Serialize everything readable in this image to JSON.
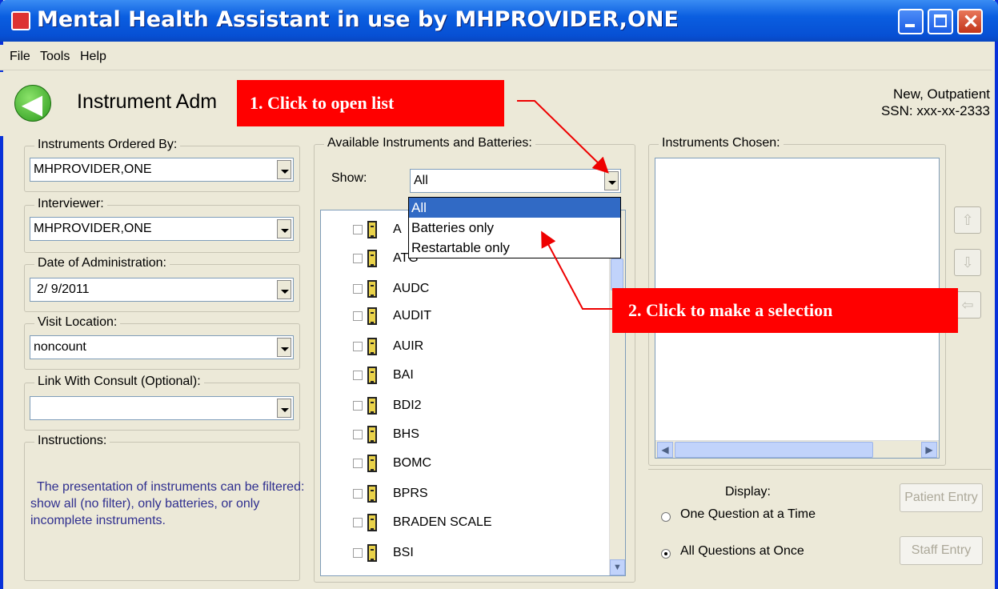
{
  "window": {
    "title": "Mental Health Assistant in use by MHPROVIDER,ONE"
  },
  "menu": [
    "File",
    "Tools",
    "Help"
  ],
  "header": {
    "title": "Instrument Adm",
    "patient_type": "New, Outpatient",
    "ssn": "SSN: xxx-xx-2333"
  },
  "callouts": {
    "first": "1. Click to open list",
    "second": "2. Click to make a selection"
  },
  "left": {
    "ordered_by_label": "Instruments Ordered By:",
    "ordered_by_value": "MHPROVIDER,ONE",
    "interviewer_label": "Interviewer:",
    "interviewer_value": "MHPROVIDER,ONE",
    "date_label": "Date of Administration:",
    "date_value": "2/ 9/2011",
    "location_label": "Visit Location:",
    "location_value": "noncount",
    "consult_label": "Link With Consult (Optional):",
    "consult_value": "",
    "instructions_label": "Instructions:",
    "instructions_text": "The presentation of instruments can be filtered: show all (no filter), only batteries, or only incomplete instruments."
  },
  "available": {
    "label": "Available Instruments and Batteries:",
    "show_label": "Show:",
    "show_value": "All",
    "options": [
      "All",
      "Batteries only",
      "Restartable only"
    ],
    "items": [
      "A",
      "ATG",
      "AUDC",
      "AUDIT",
      "AUIR",
      "BAI",
      "BDI2",
      "BHS",
      "BOMC",
      "BPRS",
      "BRADEN SCALE",
      "BSI"
    ]
  },
  "chosen": {
    "label": "Instruments Chosen:"
  },
  "display": {
    "label": "Display:",
    "option_one": "One Question at a Time",
    "option_all": "All Questions at Once",
    "patient_entry": "Patient Entry",
    "staff_entry": "Staff Entry"
  }
}
